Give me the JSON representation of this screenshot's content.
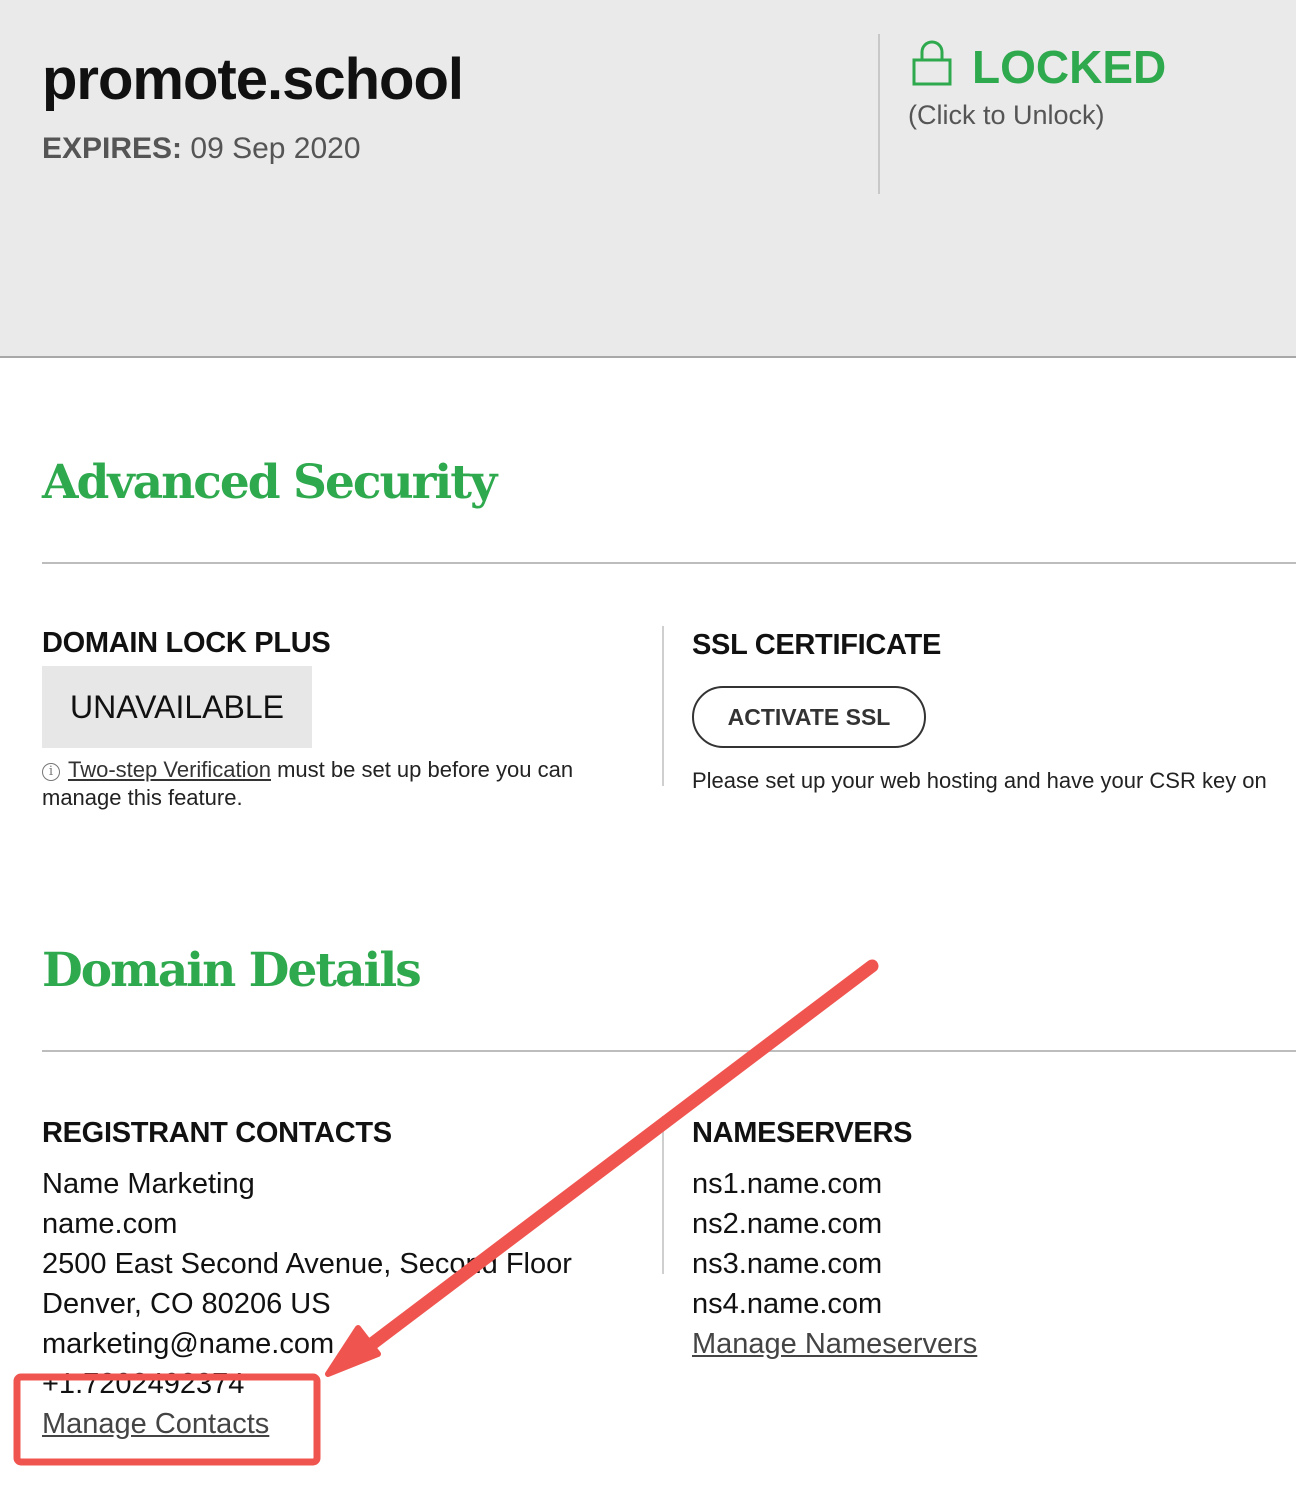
{
  "header": {
    "domain": "promote.school",
    "expires_label": "EXPIRES:",
    "expires_value": "09 Sep 2020",
    "lock_status": "LOCKED",
    "lock_hint": "(Click to Unlock)"
  },
  "security": {
    "title": "Advanced Security",
    "domain_lock": {
      "heading": "DOMAIN LOCK PLUS",
      "status": "UNAVAILABLE",
      "note_link": "Two-step Verification",
      "note_text": " must be set up before you can manage this feature."
    },
    "ssl": {
      "heading": "SSL CERTIFICATE",
      "button": "ACTIVATE SSL",
      "note": "Please set up your web hosting and have your CSR key on"
    }
  },
  "details": {
    "title": "Domain Details",
    "registrant": {
      "heading": "REGISTRANT CONTACTS",
      "lines": [
        "Name Marketing",
        "name.com",
        "2500 East Second Avenue, Second Floor",
        "Denver, CO 80206 US",
        "marketing@name.com",
        "+1.7202492374"
      ],
      "manage_link": "Manage Contacts"
    },
    "nameservers": {
      "heading": "NAMESERVERS",
      "servers": [
        "ns1.name.com",
        "ns2.name.com",
        "ns3.name.com",
        "ns4.name.com"
      ],
      "manage_link": "Manage Nameservers"
    }
  },
  "annotation": {
    "color": "#f0544f"
  },
  "colors": {
    "accent_green": "#2fa94e",
    "header_bg": "#eaeaea"
  }
}
